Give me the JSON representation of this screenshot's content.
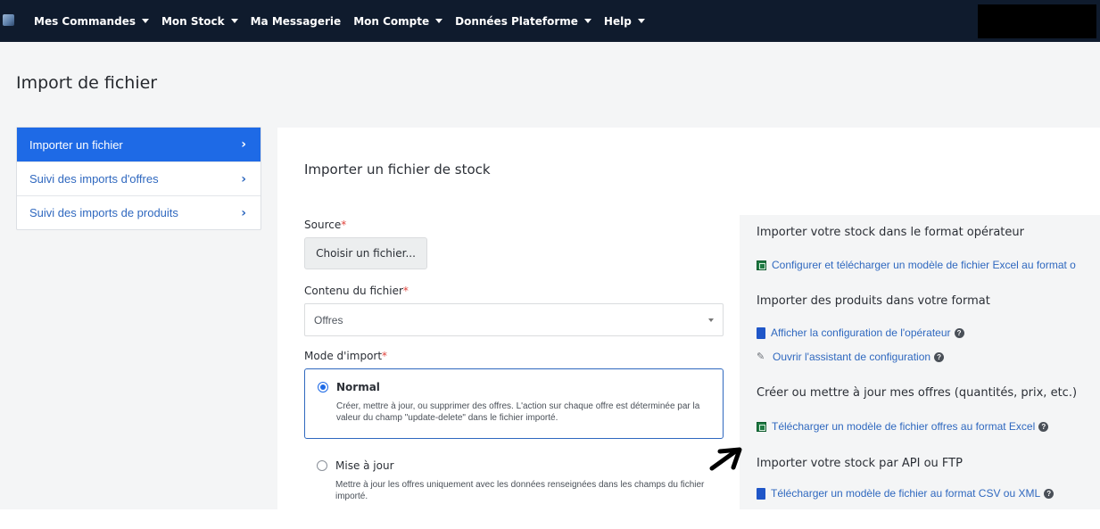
{
  "nav": {
    "items": [
      {
        "label": "Mes Commandes",
        "has_caret": true
      },
      {
        "label": "Mon Stock",
        "has_caret": true
      },
      {
        "label": "Ma Messagerie",
        "has_caret": false
      },
      {
        "label": "Mon Compte",
        "has_caret": true
      },
      {
        "label": "Données Plateforme",
        "has_caret": true
      },
      {
        "label": "Help",
        "has_caret": true
      }
    ]
  },
  "page": {
    "title": "Import de fichier"
  },
  "sidebar": {
    "items": [
      {
        "label": "Importer un fichier",
        "active": true
      },
      {
        "label": "Suivi des imports d'offres",
        "active": false
      },
      {
        "label": "Suivi des imports de produits",
        "active": false
      }
    ]
  },
  "form": {
    "title": "Importer un fichier de stock",
    "source_label": "Source",
    "file_button": "Choisir un fichier...",
    "content_label": "Contenu du fichier",
    "content_value": "Offres",
    "mode_label": "Mode d'import",
    "required_mark": "*",
    "modes": [
      {
        "label": "Normal",
        "selected": true,
        "description": "Créer, mettre à jour, ou supprimer des offres. L'action sur chaque offre est déterminée par la valeur du champ \"update-delete\" dans le fichier importé."
      },
      {
        "label": "Mise à jour",
        "selected": false,
        "description": "Mettre à jour les offres uniquement avec les données renseignées dans les champs du fichier importé."
      }
    ]
  },
  "right": {
    "sections": [
      {
        "heading": "Importer votre stock dans le format opérateur",
        "links": [
          {
            "icon": "excel-icon",
            "label": "Configurer et télécharger un modèle de fichier Excel au format o",
            "help": false
          }
        ]
      },
      {
        "heading": "Importer des produits dans votre format",
        "links": [
          {
            "icon": "book-icon",
            "label": "Afficher la configuration de l'opérateur",
            "help": true
          },
          {
            "icon": "wand-icon",
            "label": "Ouvrir l'assistant de configuration",
            "help": true
          }
        ]
      },
      {
        "heading": "Créer ou mettre à jour mes offres (quantités, prix, etc.)",
        "links": [
          {
            "icon": "excel-icon",
            "label": "Télécharger un modèle de fichier offres au format Excel",
            "help": true
          }
        ]
      },
      {
        "heading": "Importer votre stock par API ou FTP",
        "links": [
          {
            "icon": "book-icon",
            "label": "Télécharger un modèle de fichier au format CSV ou XML",
            "help": true
          }
        ]
      }
    ]
  },
  "colors": {
    "nav_bg": "#0f1b2d",
    "accent": "#1e6ae6",
    "link": "#2f68bf",
    "required": "#e0443c"
  }
}
